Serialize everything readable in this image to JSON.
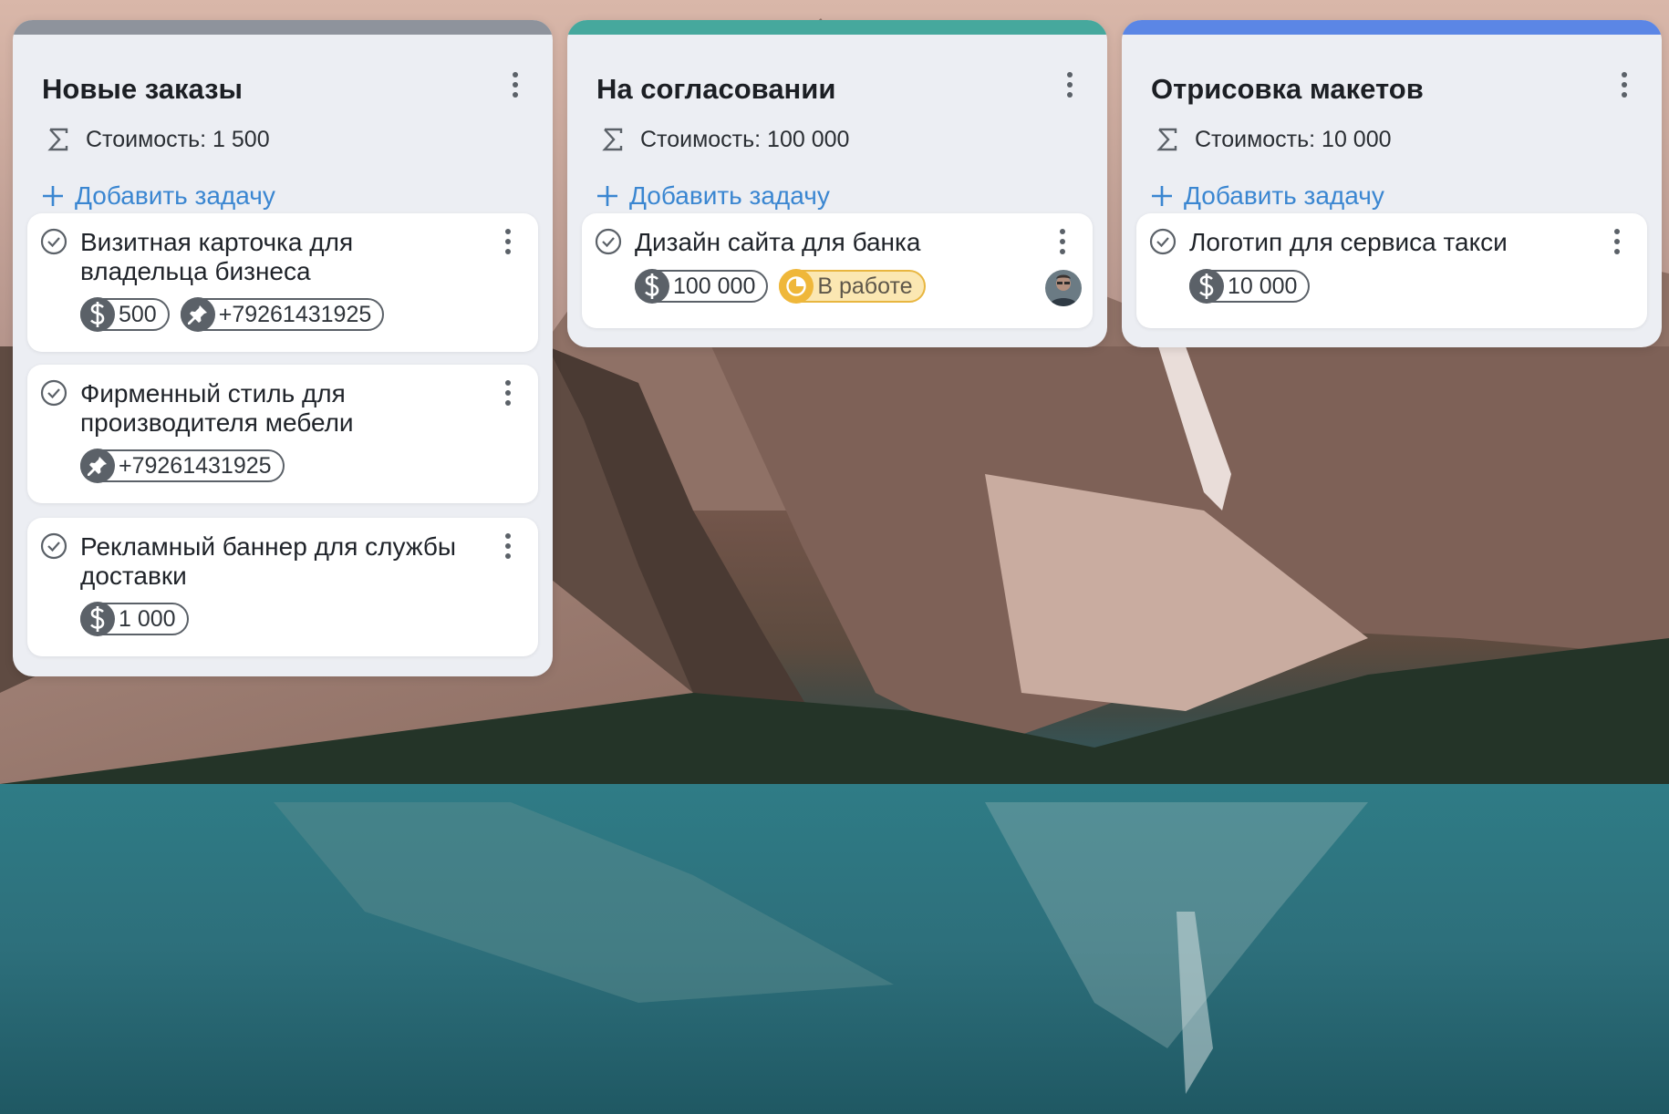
{
  "columns": [
    {
      "title": "Новые заказы",
      "accent": "#8e939c",
      "sum": "Стоимость: 1 500",
      "add_label": "Добавить задачу",
      "cards": [
        {
          "title_line1": "Визитная карточка для",
          "title_line2": "владельца бизнеса",
          "chips": {
            "price": "500",
            "phone": "+79261431925"
          }
        },
        {
          "title_line1": "Фирменный стиль для",
          "title_line2": "производителя мебели",
          "chips": {
            "phone": "+79261431925"
          }
        },
        {
          "title_line1": "Рекламный баннер для службы",
          "title_line2": "доставки",
          "chips": {
            "price": "1 000"
          }
        }
      ]
    },
    {
      "title": "На согласовании",
      "accent": "#46a89d",
      "sum": "Стоимость: 100 000",
      "add_label": "Добавить задачу",
      "cards": [
        {
          "title_line1": "Дизайн сайта для банка",
          "chips": {
            "price": "100 000",
            "status": "В работе"
          },
          "avatar": "user-avatar"
        }
      ]
    },
    {
      "title": "Отрисовка макетов",
      "accent": "#5b86e5",
      "sum": "Стоимость: 10 000",
      "add_label": "Добавить задачу",
      "cards": [
        {
          "title_line1": "Логотип для сервиса такси",
          "chips": {
            "price": "10 000"
          }
        }
      ]
    }
  ],
  "colors": {
    "link": "#3a86d1",
    "status_bg": "#fbe7b2",
    "status_border": "#e8b640",
    "chip_icon": "#5b6168"
  },
  "icons": {
    "sum": "sigma-icon",
    "add": "plus-icon",
    "menu": "more-vertical-icon",
    "check": "check-circle-icon",
    "price": "dollar-icon",
    "phone": "pin-icon",
    "status": "clock-icon"
  }
}
